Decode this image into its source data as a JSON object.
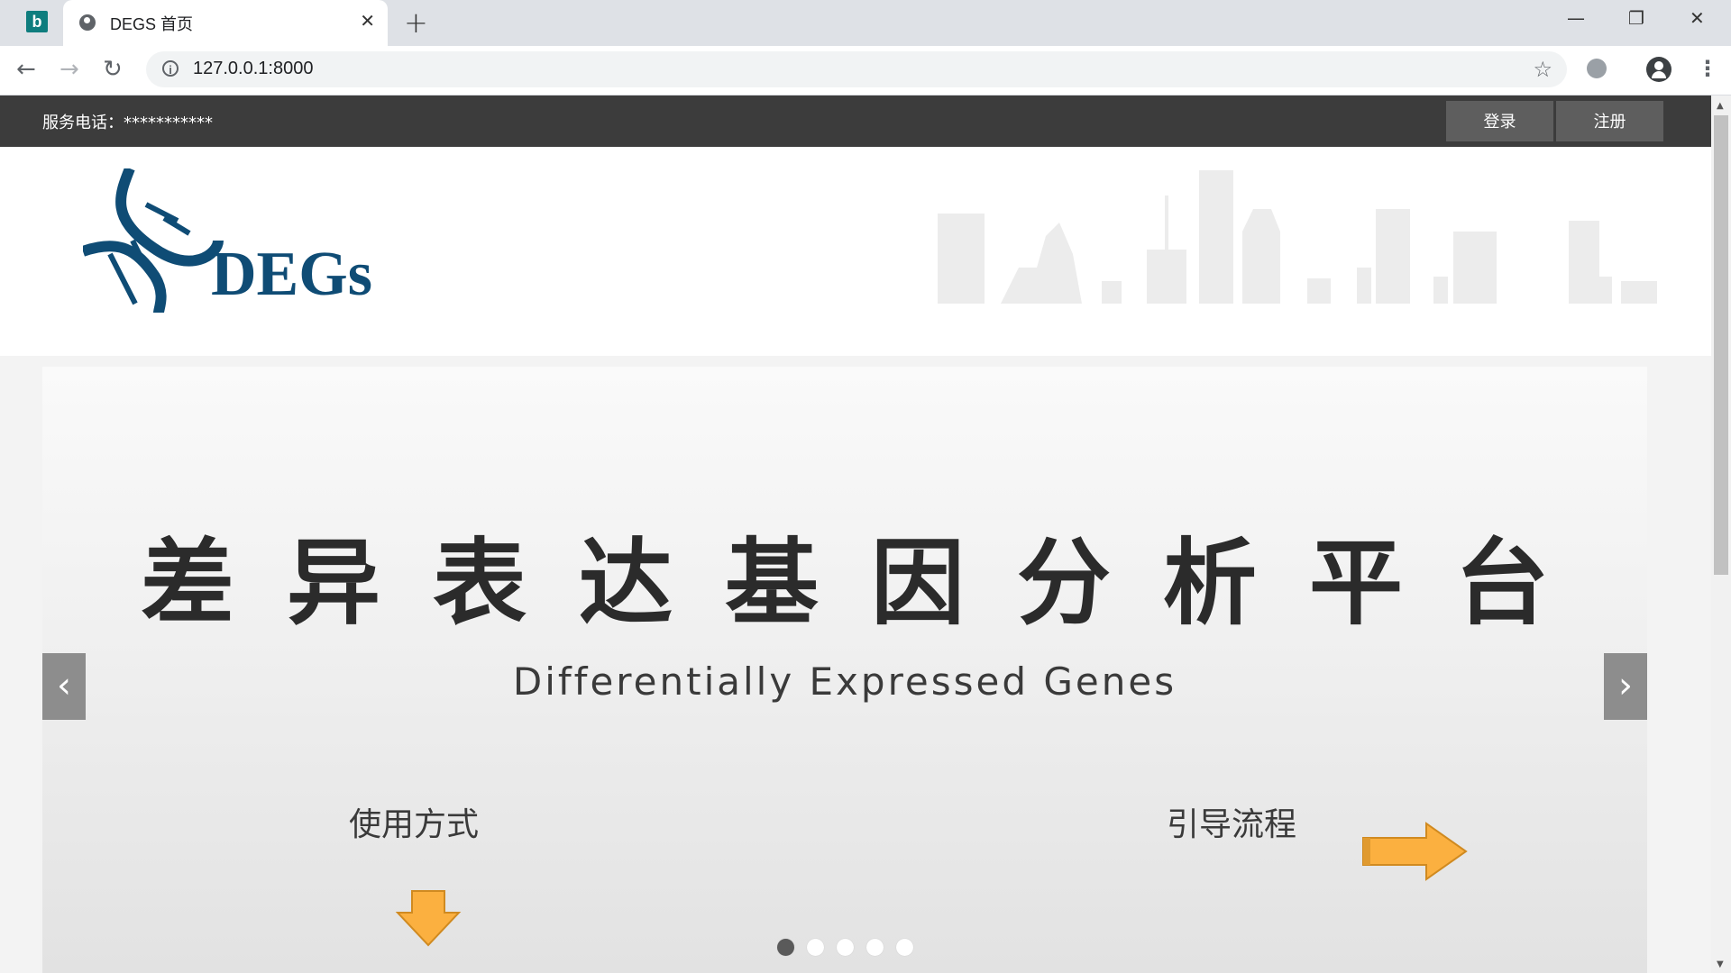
{
  "browser": {
    "tab_title": "DEGS 首页",
    "url": "127.0.0.1:8000",
    "new_tab_symbol": "+",
    "close_symbol": "✕",
    "min_symbol": "—",
    "restore_symbol": "❐",
    "win_close_symbol": "✕",
    "back_symbol": "←",
    "forward_symbol": "→",
    "reload_symbol": "↻",
    "star_symbol": "☆",
    "menu_symbol": "⋮"
  },
  "topbar": {
    "phone": "服务电话：***********",
    "login": "登录",
    "register": "注册"
  },
  "logo": {
    "text": "DEGs",
    "color": "#0f4c75"
  },
  "banner": {
    "title": "差异表达基因分析平台",
    "subtitle": "Differentially Expressed Genes",
    "usage_label": "使用方式",
    "guide_label": "引导流程",
    "prev_symbol": "‹",
    "next_symbol": "›",
    "slide_count": 5,
    "active_slide": 1,
    "arrow_color": "#fbb040"
  }
}
